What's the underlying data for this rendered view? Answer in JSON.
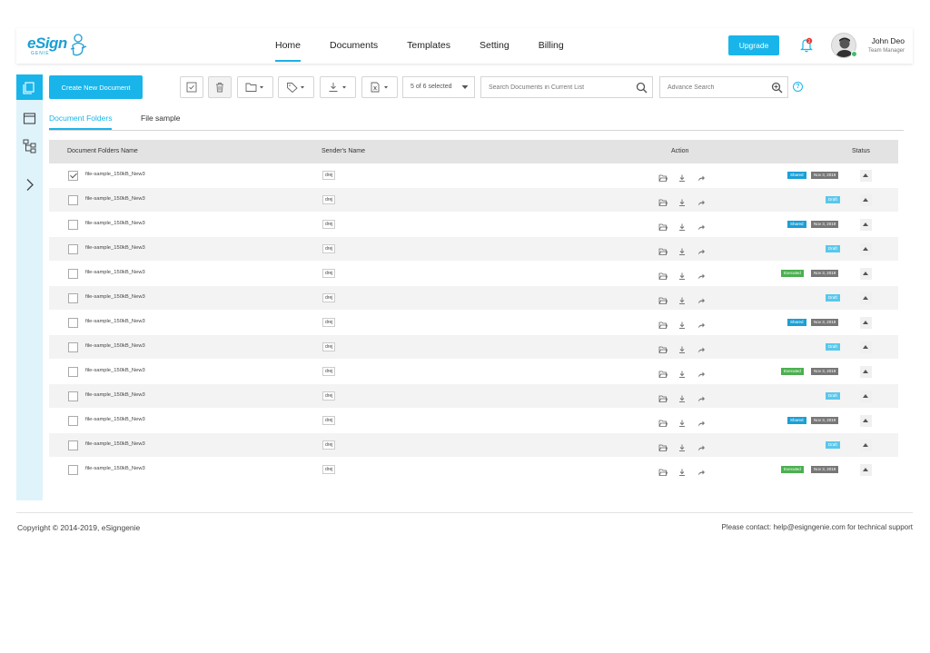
{
  "brand": {
    "logo_text": "eSign",
    "logo_sub": "GENIE"
  },
  "nav": {
    "items": [
      "Home",
      "Documents",
      "Templates",
      "Setting",
      "Billing"
    ],
    "active": "Home"
  },
  "header": {
    "upgrade_label": "Upgrade",
    "notification_count": "2",
    "user_name": "John Deo",
    "user_role": "Team Manager"
  },
  "toolbar": {
    "create_label": "Create New Document",
    "selection_label": "5 of 6 selected",
    "search_placeholder": "Search Documents in Current List",
    "advanced_placeholder": "Advance Search",
    "help_label": "?"
  },
  "tabs": [
    {
      "label": "Document Folders",
      "active": true
    },
    {
      "label": "File sample",
      "active": false
    }
  ],
  "table": {
    "columns": {
      "name": "Document Folders Name",
      "sender": "Sender's Name",
      "action": "Action",
      "status": "Status"
    },
    "rows": [
      {
        "name": "file-sample_150kB_New3",
        "sender": "drej",
        "checked": true,
        "status": "Shared",
        "date": "Nov 3, 2019"
      },
      {
        "name": "file-sample_150kB_New3",
        "sender": "drej",
        "checked": false,
        "status": "Draft",
        "date": ""
      },
      {
        "name": "file-sample_150kB_New3",
        "sender": "drej",
        "checked": false,
        "status": "Shared",
        "date": "Nov 3, 2019"
      },
      {
        "name": "file-sample_150kB_New3",
        "sender": "drej",
        "checked": false,
        "status": "Draft",
        "date": ""
      },
      {
        "name": "file-sample_150kB_New3",
        "sender": "drej",
        "checked": false,
        "status": "Executed",
        "date": "Nov 3, 2019"
      },
      {
        "name": "file-sample_150kB_New3",
        "sender": "drej",
        "checked": false,
        "status": "Draft",
        "date": ""
      },
      {
        "name": "file-sample_150kB_New3",
        "sender": "drej",
        "checked": false,
        "status": "Shared",
        "date": "Nov 3, 2019"
      },
      {
        "name": "file-sample_150kB_New3",
        "sender": "drej",
        "checked": false,
        "status": "Draft",
        "date": ""
      },
      {
        "name": "file-sample_150kB_New3",
        "sender": "drej",
        "checked": false,
        "status": "Executed",
        "date": "Nov 3, 2019"
      },
      {
        "name": "file-sample_150kB_New3",
        "sender": "drej",
        "checked": false,
        "status": "Draft",
        "date": ""
      },
      {
        "name": "file-sample_150kB_New3",
        "sender": "drej",
        "checked": false,
        "status": "Shared",
        "date": "Nov 3, 2019"
      },
      {
        "name": "file-sample_150kB_New3",
        "sender": "drej",
        "checked": false,
        "status": "Draft",
        "date": ""
      },
      {
        "name": "file-sample_150kB_New3",
        "sender": "drej",
        "checked": false,
        "status": "Executed",
        "date": "Nov 3, 2019"
      }
    ]
  },
  "footer": {
    "copyright": "Copyright © 2014-2019, eSigngenie",
    "support": "Please contact: help@esigngenie.com for technical support"
  },
  "colors": {
    "accent": "#19b5ea",
    "shared": "#1b9fd6",
    "draft": "#5ac8ec",
    "executed": "#4caf50",
    "date": "#777777"
  },
  "icons": [
    "documents-icon",
    "calendar-icon",
    "tree-icon",
    "chevron-right-icon",
    "checkbox-icon",
    "trash-icon",
    "folder-icon",
    "tag-icon",
    "download-icon",
    "export-icon",
    "search-icon",
    "zoom-icon",
    "bell-icon",
    "share-icon"
  ]
}
